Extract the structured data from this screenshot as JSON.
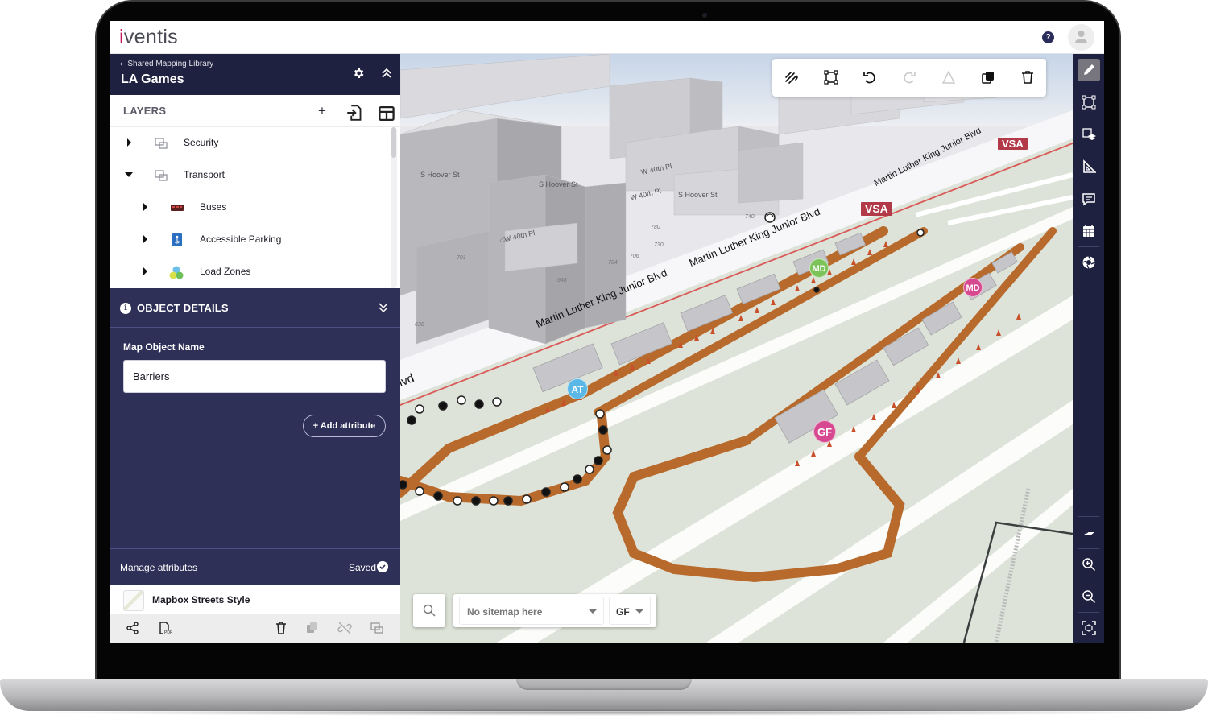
{
  "app": {
    "logo_prefix": "i",
    "logo_rest": "ventis",
    "brand_color": "#c2185b",
    "help_label": "?"
  },
  "project": {
    "breadcrumb": "Shared Mapping Library",
    "title": "LA Games"
  },
  "layers": {
    "title": "LAYERS",
    "items": [
      {
        "label": "Security",
        "expanded": false,
        "level": 0,
        "icon": "layer-group-icon"
      },
      {
        "label": "Transport",
        "expanded": true,
        "level": 0,
        "icon": "layer-group-icon"
      },
      {
        "label": "Buses",
        "expanded": false,
        "level": 1,
        "icon": "bus-icon"
      },
      {
        "label": "Accessible Parking",
        "expanded": false,
        "level": 1,
        "icon": "accessible-parking-icon"
      },
      {
        "label": "Load Zones",
        "expanded": false,
        "level": 1,
        "icon": "load-zones-icon"
      }
    ]
  },
  "details": {
    "title": "OBJECT DETAILS",
    "field_label": "Map Object Name",
    "field_value": "Barriers",
    "add_attribute": "+ Add attribute",
    "manage_attributes": "Manage attributes",
    "status": "Saved"
  },
  "basemap": {
    "name": "Mapbox Streets Style"
  },
  "map": {
    "streets": [
      "Martin Luther King Junior Blvd",
      "Martin Luther King Junior Blvd",
      "Martin Luther King Junior Blvd",
      "lvd",
      "W 40th Pl",
      "W 40th Pl",
      "W 40th Pl",
      "S Hoover St",
      "S Hoover St",
      "S Hoover St"
    ],
    "address_numbers": [
      "740",
      "780",
      "730",
      "706",
      "704",
      "648",
      "638",
      "701",
      "703"
    ],
    "zone_labels": [
      "VSA",
      "VSA"
    ],
    "pins": [
      {
        "label": "AT",
        "color": "#5bb8e6"
      },
      {
        "label": "MD",
        "color": "#7cc35a"
      },
      {
        "label": "MD",
        "color": "#d6488f"
      },
      {
        "label": "GF",
        "color": "#d6488f"
      }
    ],
    "sitemap_placeholder": "No sitemap here",
    "level_value": "GF"
  }
}
